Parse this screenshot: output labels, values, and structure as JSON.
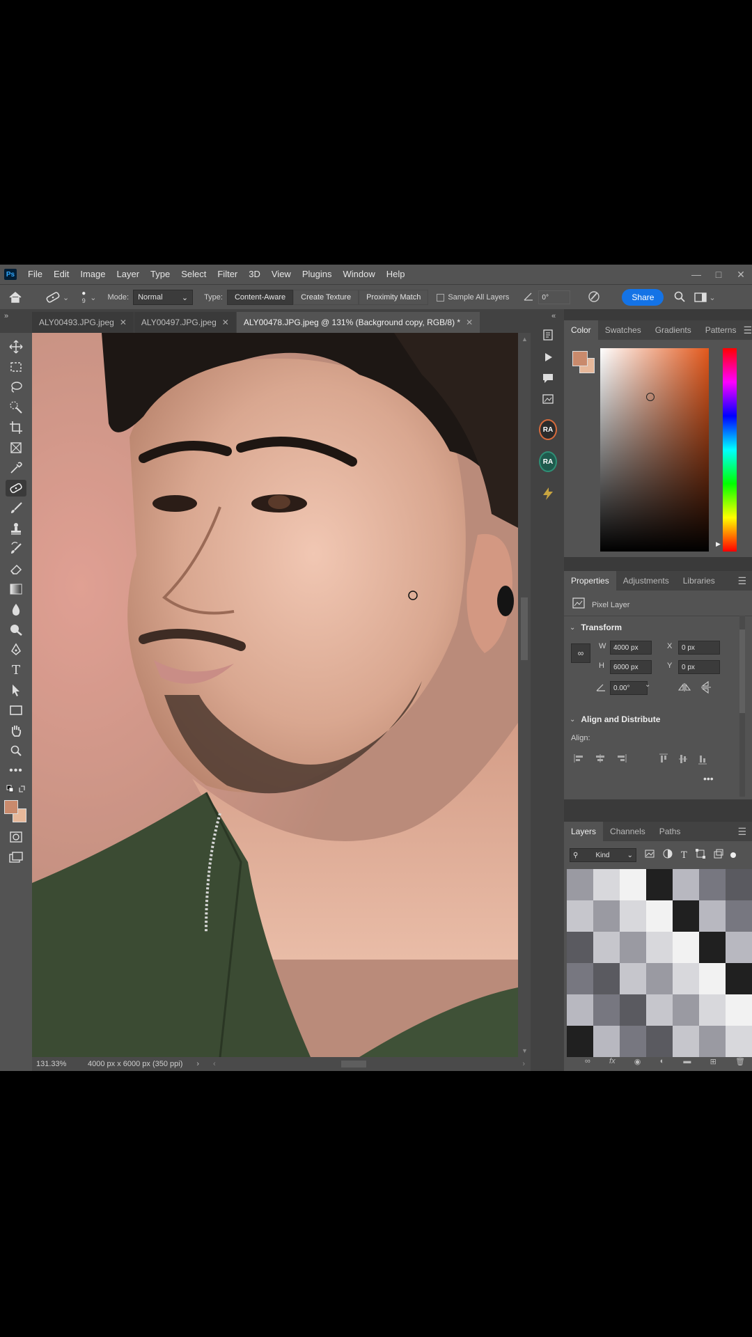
{
  "app": {
    "name": "Ps"
  },
  "menu": [
    "File",
    "Edit",
    "Image",
    "Layer",
    "Type",
    "Select",
    "Filter",
    "3D",
    "View",
    "Plugins",
    "Window",
    "Help"
  ],
  "options_bar": {
    "brush_size": "9",
    "mode_label": "Mode:",
    "mode_value": "Normal",
    "type_label": "Type:",
    "type_buttons": [
      "Content-Aware",
      "Create Texture",
      "Proximity Match"
    ],
    "sample_all_layers": "Sample All Layers",
    "angle_value": "0°",
    "share_label": "Share"
  },
  "tabs": [
    {
      "label": "ALY00493.JPG.jpeg",
      "active": false
    },
    {
      "label": "ALY00497.JPG.jpeg",
      "active": false
    },
    {
      "label": "ALY00478.JPG.jpeg @ 131% (Background copy, RGB/8) *",
      "active": true
    }
  ],
  "status": {
    "zoom": "131.33%",
    "doc_info": "4000 px x 6000 px (350 ppi)"
  },
  "colors": {
    "foreground": "#c98a6c",
    "background": "#e7b89a",
    "accent": "#1473e6"
  },
  "color_panel": {
    "tabs": [
      "Color",
      "Swatches",
      "Gradients",
      "Patterns"
    ]
  },
  "properties_panel": {
    "tabs": [
      "Properties",
      "Adjustments",
      "Libraries"
    ],
    "layer_type": "Pixel Layer",
    "transform_title": "Transform",
    "w_label": "W",
    "w_value": "4000 px",
    "h_label": "H",
    "h_value": "6000 px",
    "x_label": "X",
    "x_value": "0 px",
    "y_label": "Y",
    "y_value": "0 px",
    "angle_value": "0.00°",
    "align_title": "Align and Distribute",
    "align_label": "Align:"
  },
  "layers_panel": {
    "tabs": [
      "Layers",
      "Channels",
      "Paths"
    ],
    "filter_kind": "Kind"
  },
  "strip": {
    "ra1": "RA",
    "ra2": "RA"
  }
}
